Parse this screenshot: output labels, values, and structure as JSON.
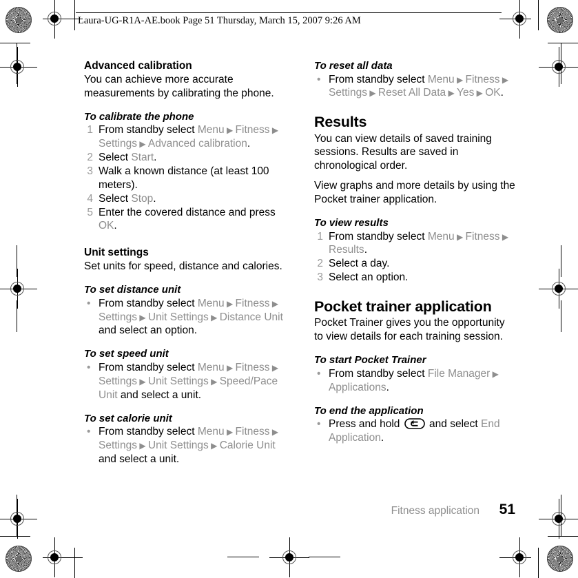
{
  "header": {
    "text": "Laura-UG-R1A-AE.book  Page 51  Thursday, March 15, 2007  9:26 AM"
  },
  "left_column": {
    "section_advanced_calibration": {
      "heading": "Advanced calibration",
      "body": "You can achieve more accurate measurements by calibrating the phone.",
      "procedure_heading": "To calibrate the phone",
      "steps": [
        {
          "num": "1",
          "lead": "From standby select ",
          "path": [
            "Menu",
            "Fitness",
            "Settings",
            "Advanced calibration"
          ],
          "tail": "."
        },
        {
          "num": "2",
          "lead": "Select ",
          "path": [
            "Start"
          ],
          "tail": "."
        },
        {
          "num": "3",
          "lead": "Walk a known distance (at least 100 meters).",
          "path": [],
          "tail": ""
        },
        {
          "num": "4",
          "lead": "Select ",
          "path": [
            "Stop"
          ],
          "tail": "."
        },
        {
          "num": "5",
          "lead": "Enter the covered distance and press ",
          "path": [
            "OK"
          ],
          "tail": "."
        }
      ]
    },
    "section_unit_settings": {
      "heading": "Unit settings",
      "body": "Set units for speed, distance and calories.",
      "distance": {
        "procedure_heading": "To set distance unit",
        "bullet": "•",
        "lead": "From standby select ",
        "path": [
          "Menu",
          "Fitness",
          "Settings",
          "Unit Settings",
          "Distance Unit"
        ],
        "tail": " and select an option."
      },
      "speed": {
        "procedure_heading": "To set speed unit",
        "bullet": "•",
        "lead": "From standby select ",
        "path": [
          "Menu",
          "Fitness",
          "Settings",
          "Unit Settings",
          "Speed/Pace Unit"
        ],
        "tail": " and select a unit."
      },
      "calorie": {
        "procedure_heading": "To set calorie unit",
        "bullet": "•",
        "lead": "From standby select ",
        "path": [
          "Menu",
          "Fitness",
          "Settings",
          "Unit Settings",
          "Calorie Unit"
        ],
        "tail": " and select a unit."
      }
    }
  },
  "right_column": {
    "reset_all_data": {
      "procedure_heading": "To reset all data",
      "bullet": "•",
      "lead": "From standby select ",
      "path": [
        "Menu",
        "Fitness",
        "Settings",
        "Reset All Data",
        "Yes",
        "OK"
      ],
      "tail": "."
    },
    "section_results": {
      "heading": "Results",
      "body1": "You can view details of saved training sessions. Results are saved in chronological order.",
      "body2": "View graphs and more details by using the Pocket trainer application.",
      "procedure_heading": "To view results",
      "steps": [
        {
          "num": "1",
          "lead": "From standby select ",
          "path": [
            "Menu",
            "Fitness",
            "Results"
          ],
          "tail": "."
        },
        {
          "num": "2",
          "lead": "Select a day.",
          "path": [],
          "tail": ""
        },
        {
          "num": "3",
          "lead": "Select an option.",
          "path": [],
          "tail": ""
        }
      ]
    },
    "section_pocket_trainer": {
      "heading": "Pocket trainer application",
      "body": "Pocket Trainer gives you the opportunity to view details for each training session.",
      "start": {
        "procedure_heading": "To start Pocket Trainer",
        "bullet": "•",
        "lead": "From standby select ",
        "path": [
          "File Manager",
          "Applications"
        ],
        "tail": "."
      },
      "end": {
        "procedure_heading": "To end the application",
        "bullet": "•",
        "lead": "Press and hold ",
        "key_icon": "back-key-icon",
        "mid": " and select ",
        "path": [
          "End Application"
        ],
        "tail": "."
      }
    }
  },
  "footer": {
    "label": "Fitness application",
    "page_number": "51"
  },
  "colors": {
    "menu_path_gray": "#8e8e8e",
    "marker_gray": "#9a9a9a",
    "body_black": "#000000"
  },
  "symbols": {
    "arrow": "▶"
  }
}
